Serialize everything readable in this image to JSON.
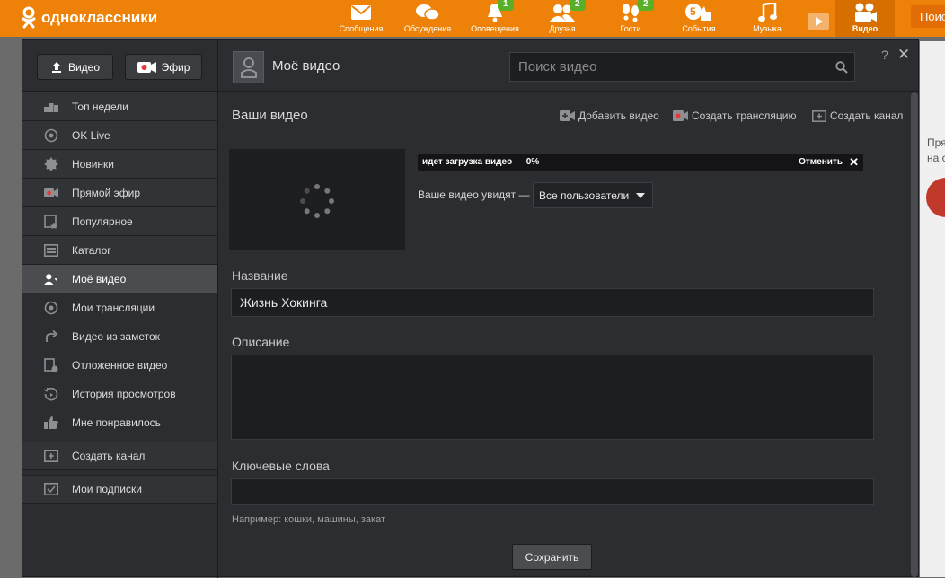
{
  "topbar": {
    "logo_text": "одноклассники",
    "nav": [
      {
        "label": "Сообщения",
        "icon": "envelope-icon",
        "badge": ""
      },
      {
        "label": "Обсуждения",
        "icon": "chat-bubbles-icon",
        "badge": ""
      },
      {
        "label": "Оповещения",
        "icon": "bell-icon",
        "badge": "1"
      },
      {
        "label": "Друзья",
        "icon": "friends-icon",
        "badge": "2"
      },
      {
        "label": "Гости",
        "icon": "footprints-icon",
        "badge": "2"
      },
      {
        "label": "События",
        "icon": "events-like-icon",
        "badge": ""
      },
      {
        "label": "Музыка",
        "icon": "music-note-icon",
        "badge": ""
      },
      {
        "label": "Видео",
        "icon": "video-camera-icon",
        "badge": ""
      }
    ],
    "events_count": "5",
    "search_button": "Поиск"
  },
  "toolbar": {
    "video_button": "Видео",
    "live_button": "Эфир",
    "page_title": "Моё видео",
    "search_placeholder": "Поиск видео",
    "help": "?",
    "close": "✕"
  },
  "sidebar": {
    "items": [
      {
        "label": "Топ недели",
        "icon": "podium-icon"
      },
      {
        "label": "OK Live",
        "icon": "ok-live-icon"
      },
      {
        "label": "Новинки",
        "icon": "new-badge-icon"
      },
      {
        "label": "Прямой эфир",
        "icon": "live-camera-icon"
      },
      {
        "label": "Популярное",
        "icon": "popular-film-icon"
      },
      {
        "label": "Каталог",
        "icon": "catalog-icon"
      },
      {
        "label": "Моё видео",
        "icon": "my-video-user-icon",
        "active": true
      }
    ],
    "items2": [
      {
        "label": "Мои трансляции",
        "icon": "broadcast-icon"
      },
      {
        "label": "Видео из заметок",
        "icon": "share-arrow-icon"
      },
      {
        "label": "Отложенное видео",
        "icon": "deferred-video-icon"
      },
      {
        "label": "История просмотров",
        "icon": "history-icon"
      },
      {
        "label": "Мне понравилось",
        "icon": "thumbs-up-icon"
      }
    ],
    "create_channel": "Создать канал",
    "subscriptions": "Мои подписки"
  },
  "main": {
    "heading": "Ваши видео",
    "add_video": "Добавить видео",
    "create_stream": "Создать трансляцию",
    "create_channel": "Создать канал",
    "upload_status": "идет загрузка видео — 0%",
    "upload_progress": 0,
    "cancel": "Отменить",
    "visibility_label": "Ваше видео увидят —",
    "visibility_value": "Все пользователи",
    "name_label": "Название",
    "name_value": "Жизнь Хокинга",
    "description_label": "Описание",
    "description_value": "",
    "keywords_label": "Ключевые слова",
    "keywords_value": "",
    "keywords_hint": "Например: кошки, машины, закат",
    "save_button": "Сохранить"
  },
  "right_partial": {
    "text_line1": "Пря",
    "text_line2": "на с"
  },
  "colors": {
    "brand_orange": "#ee8208",
    "badge_green": "#59b028",
    "panel_bg": "#2c2d30"
  }
}
